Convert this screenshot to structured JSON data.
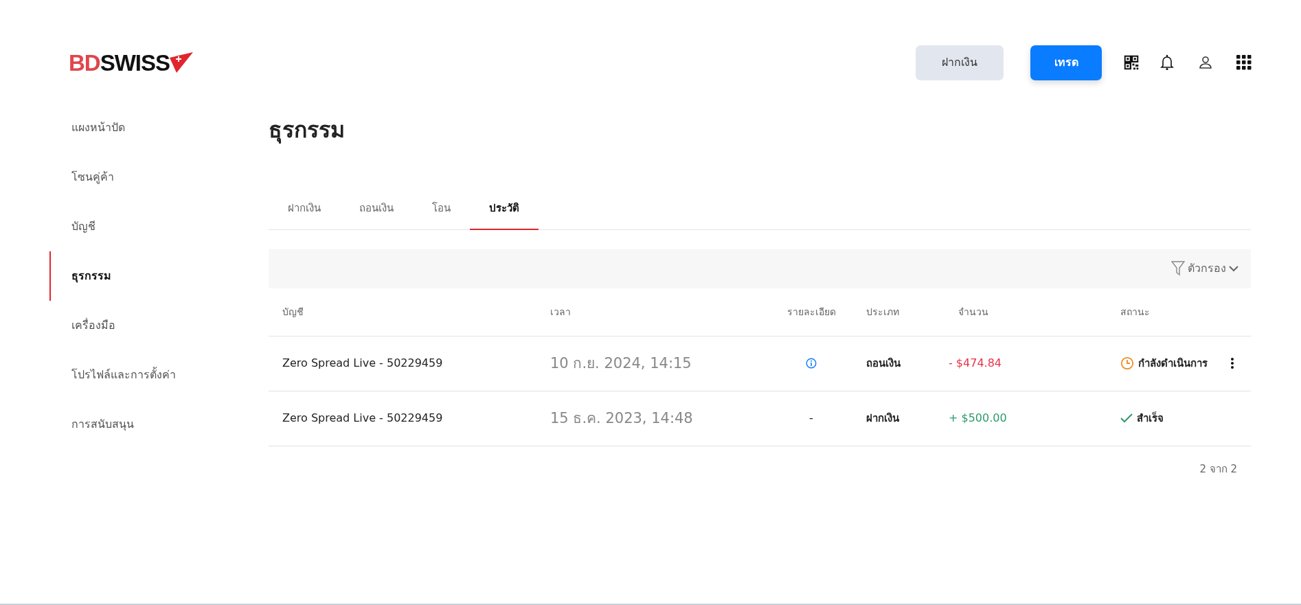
{
  "logo": {
    "part_1": "BD",
    "part_2": "SWISS"
  },
  "header": {
    "buttons": [
      {
        "label": "ฝากเงิน",
        "kind": "secondary"
      },
      {
        "label": "เทรด",
        "kind": "primary"
      }
    ]
  },
  "sidebar": {
    "items": [
      {
        "label": "แผงหน้าปัด",
        "selected": false
      },
      {
        "label": "โซนคู่ค้า",
        "selected": false
      },
      {
        "label": "บัญชี",
        "selected": false
      },
      {
        "label": "ธุรกรรม",
        "selected": true
      },
      {
        "label": "เครื่องมือ",
        "selected": false
      },
      {
        "label": "โปรไฟล์และการตั้งค่า",
        "selected": false
      },
      {
        "label": "การสนับสนุน",
        "selected": false
      }
    ]
  },
  "page_title": "ธุรกรรม",
  "tabs": [
    {
      "label": "ฝากเงิน",
      "selected": false
    },
    {
      "label": "ถอนเงิน",
      "selected": false
    },
    {
      "label": "โอน",
      "selected": false
    },
    {
      "label": "ประวัติ",
      "selected": true
    }
  ],
  "filter": {
    "label": "ตัวกรอง"
  },
  "table": {
    "columns": [
      "บัญชี",
      "เวลา",
      "รายละเอียด",
      "ประเภท",
      "จำนวน",
      "สถานะ"
    ],
    "rows": [
      {
        "account": "Zero Spread Live - 50229459",
        "time": "10 ก.ย. 2024, 14:15",
        "details": {
          "kind": "info"
        },
        "type": "ถอนเงิน",
        "amount": {
          "text": "- $474.84",
          "kind": "debit"
        },
        "status": {
          "text": "กำลังดำเนินการ",
          "kind": "pending"
        },
        "has_menu": true
      },
      {
        "account": "Zero Spread Live - 50229459",
        "time": "15 ธ.ค. 2023, 14:48",
        "details": {
          "kind": "text",
          "text": "-"
        },
        "type": "ฝากเงิน",
        "amount": {
          "text": "+ $500.00",
          "kind": "credit"
        },
        "status": {
          "text": "สำเร็จ",
          "kind": "success"
        },
        "has_menu": false
      }
    ]
  },
  "pagination": "2 จาก 2"
}
